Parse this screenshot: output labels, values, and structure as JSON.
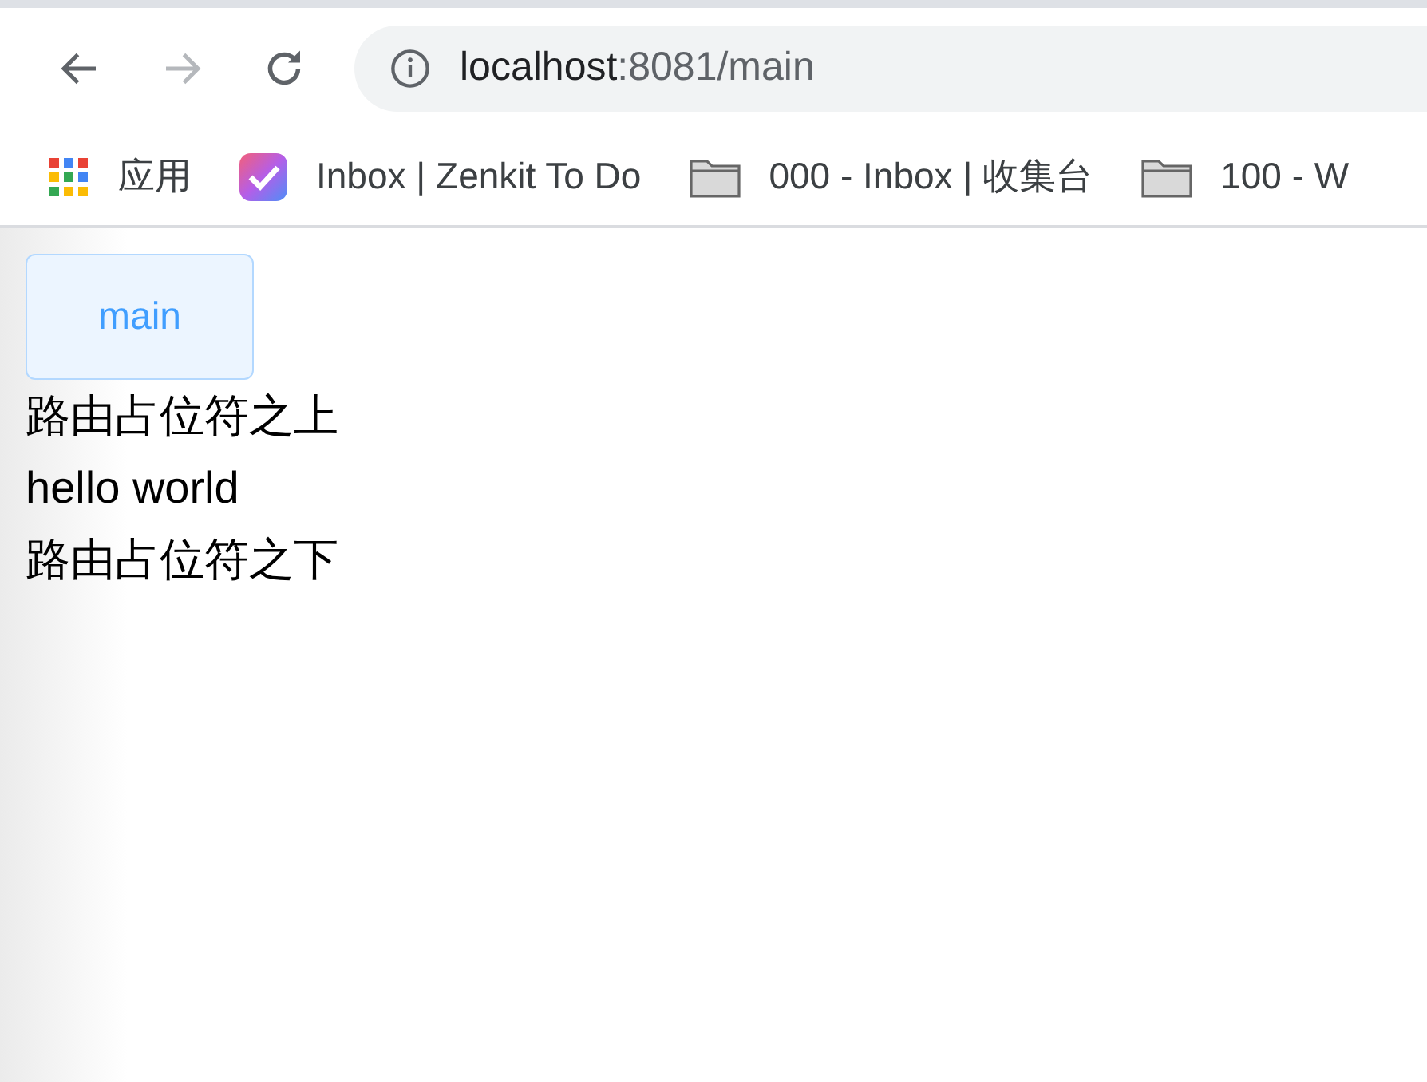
{
  "toolbar": {
    "buttons": [
      {
        "kind": "back",
        "disabled": false
      },
      {
        "kind": "forward",
        "disabled": true
      },
      {
        "kind": "reload",
        "disabled": false
      }
    ]
  },
  "address_bar": {
    "host": "localhost",
    "path": ":8081/main"
  },
  "bookmarks": [
    {
      "kind": "apps",
      "label": "应用"
    },
    {
      "kind": "app",
      "label": "Inbox | Zenkit To Do"
    },
    {
      "kind": "folder",
      "label": "000 - Inbox | 收集台"
    },
    {
      "kind": "folder",
      "label": "100 - W"
    }
  ],
  "page": {
    "button": "main",
    "lines": [
      "路由占位符之上",
      "hello world",
      "路由占位符之下"
    ]
  }
}
